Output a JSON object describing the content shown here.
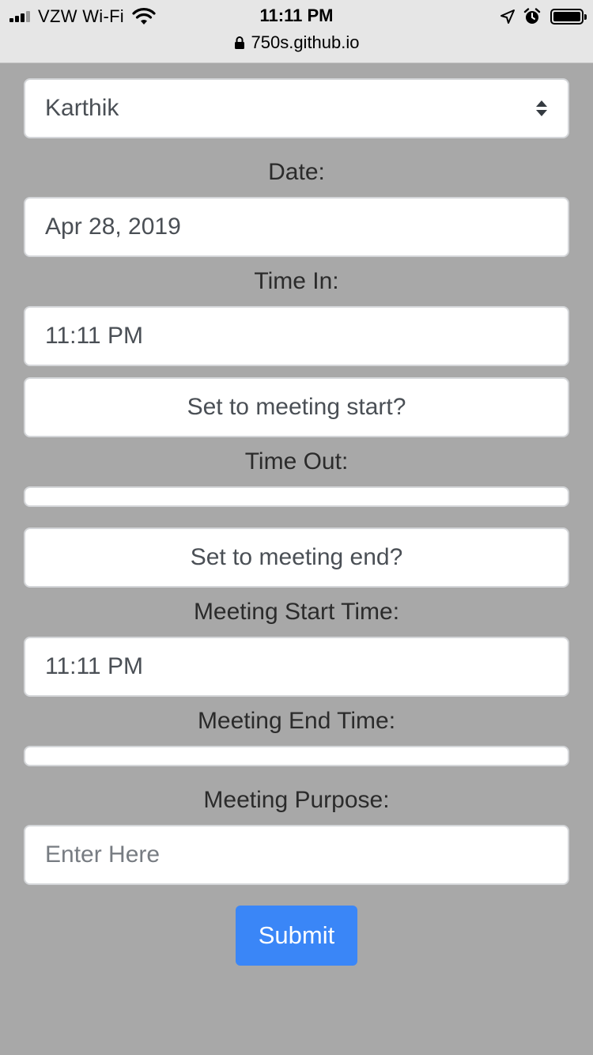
{
  "status_bar": {
    "carrier": "VZW Wi-Fi",
    "time": "11:11 PM"
  },
  "browser": {
    "url": "750s.github.io"
  },
  "form": {
    "name_select": {
      "value": "Karthik"
    },
    "date": {
      "label": "Date:",
      "value": "Apr 28, 2019"
    },
    "time_in": {
      "label": "Time In:",
      "value": "11:11 PM"
    },
    "set_start_button": "Set to meeting start?",
    "time_out": {
      "label": "Time Out:",
      "value": ""
    },
    "set_end_button": "Set to meeting end?",
    "meeting_start": {
      "label": "Meeting Start Time:",
      "value": "11:11 PM"
    },
    "meeting_end": {
      "label": "Meeting End Time:",
      "value": ""
    },
    "purpose": {
      "label": "Meeting Purpose:",
      "placeholder": "Enter Here"
    },
    "submit": "Submit"
  },
  "colors": {
    "page_background": "#a8a8a8",
    "submit_button": "#3a86f7"
  }
}
